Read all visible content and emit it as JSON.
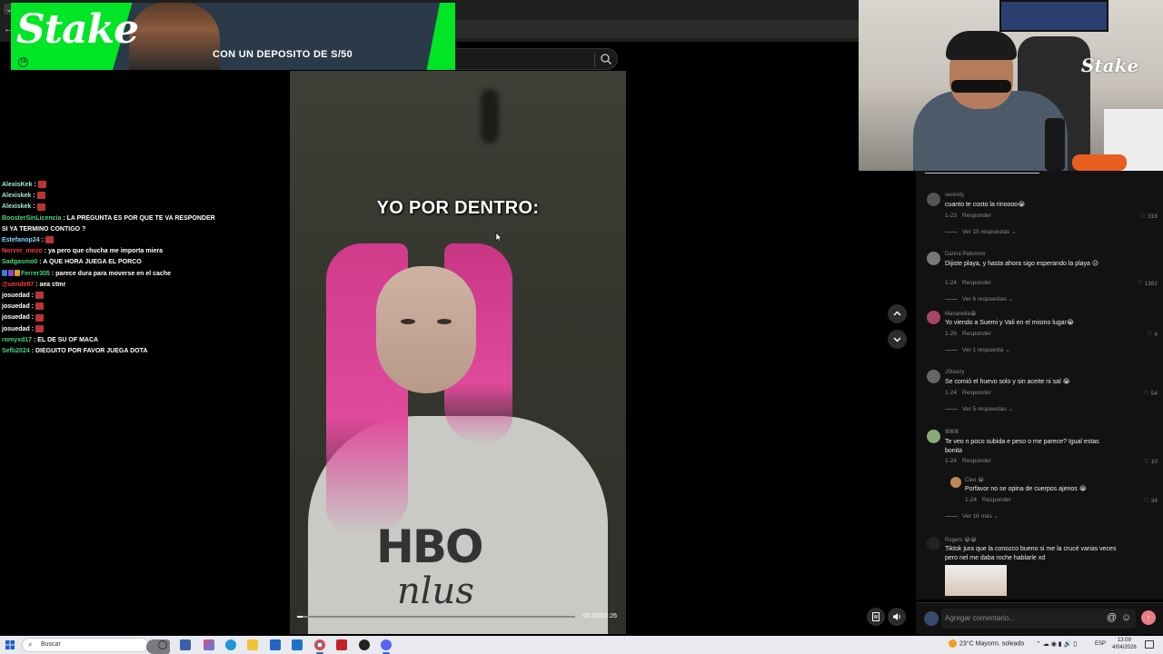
{
  "banner": {
    "brand": "Stake",
    "promo": "CON UN DEPOSITO DE S/50",
    "age": "18"
  },
  "search": {
    "placeholder": ""
  },
  "chat": [
    {
      "user": "AlexisKek",
      "color": "#a0f0d0",
      "msg": "",
      "emote": true
    },
    {
      "user": "Alexiskek",
      "color": "#a0f0d0",
      "msg": "",
      "emote": true
    },
    {
      "user": "Alexiskek",
      "color": "#a0f0d0",
      "msg": "",
      "emote": true
    },
    {
      "user": "BoosterSinLicencia",
      "color": "#4ad67a",
      "msg": ": LA PREGUNTA ES POR QUE TE VA RESPONDER SI YA TERMINO CONTIGO ?",
      "emote": false,
      "wrap": true
    },
    {
      "user": "Estefanop24",
      "color": "#7fd8ff",
      "msg": "",
      "emote": true
    },
    {
      "user": "Norver_mozo",
      "color": "#ff3a3a",
      "msg": ": ya pero que chucha me importa miera",
      "emote": false
    },
    {
      "user": "Sadgasmo0",
      "color": "#4ad67a",
      "msg": ": A QUE HORA JUEGA EL PORCO",
      "emote": false
    },
    {
      "user": "Ferrer305",
      "color": "#4ad67a",
      "msg": ": parece dura para moverse en el cache",
      "emote": false,
      "badges": true
    },
    {
      "user": "@uende87",
      "color": "#ff3a3a",
      "msg": ": aea ctmr",
      "emote": false
    },
    {
      "user": "josuedad",
      "color": "#ffffff",
      "msg": "",
      "emote": true
    },
    {
      "user": "josuedad",
      "color": "#ffffff",
      "msg": "",
      "emote": true
    },
    {
      "user": "josuedad",
      "color": "#ffffff",
      "msg": "",
      "emote": true
    },
    {
      "user": "josuedad",
      "color": "#ffffff",
      "msg": "",
      "emote": true
    },
    {
      "user": "romyxd17",
      "color": "#4ad67a",
      "msg": ": EL DE SU OF MACA",
      "emote": false
    },
    {
      "user": "Sefb2024",
      "color": "#4ad67a",
      "msg": ": DIEGUITO POR FAVOR JUEGA DOTA",
      "emote": false
    }
  ],
  "video": {
    "caption": "YO POR DENTRO:",
    "shirt_brand": "HBO",
    "shirt_sub": "nlus",
    "time": "00:03/02:26",
    "progress": 0.02
  },
  "webcam": {
    "brand": "Stake"
  },
  "comments": [
    {
      "user": "serenity",
      "text": "cuanto te costo la rinoooo😭",
      "date": "1-23",
      "reply": "Responder",
      "likes": "316",
      "more": "Ver 15 respuestas",
      "avatar": "#555"
    },
    {
      "user": "Danna Palomino",
      "text": "Dijiste playa, y hasta ahora sigo esperando la playa 😐",
      "date": "1-24",
      "reply": "Responder",
      "likes": "1382",
      "more": "Ver 6 respuestas",
      "avatar": "#777"
    },
    {
      "user": "Marianella😭",
      "text": "Yo viendo a Suemi y Vali en el mismo lugar😭",
      "date": "1-26",
      "reply": "Responder",
      "likes": "4",
      "more": "Ver 1 respuesta",
      "avatar": "#a46"
    },
    {
      "user": "JSteezy",
      "text": "Se comió el huevo solo y sin aceite ni sal 😭",
      "date": "1-24",
      "reply": "Responder",
      "likes": "54",
      "more": "Ver 5 respuestas",
      "avatar": "#666"
    },
    {
      "user": "ꕤꕤꕤ",
      "text": "Te veo n poco subida e peso o me parece? Igual estas bonita",
      "date": "1-24",
      "reply": "Responder",
      "likes": "10",
      "more": "",
      "avatar": "#8a7"
    },
    {
      "user": "Cleo 😭",
      "text": "Porfavor no se opina de cuerpos ajenos 😭",
      "date": "1-24",
      "reply": "Responder",
      "likes": "34",
      "more": "Ver 16 más",
      "avatar": "#b85",
      "sub": true
    },
    {
      "user": "Rogers 😭😭",
      "text": "Tiktok jura que la conozco bueno si me la crucé varias veces pero nel me daba roche hablarle xd",
      "date": "",
      "reply": "",
      "likes": "",
      "more": "",
      "avatar": "#222",
      "thumb": true
    }
  ],
  "comment_input": {
    "placeholder": "Agregar comentario..."
  },
  "taskbar": {
    "search": "Buscar",
    "weather": "23°C  Mayorm. soleado",
    "lang": "ESP",
    "time": "13:09",
    "date": "4/04/2026"
  }
}
